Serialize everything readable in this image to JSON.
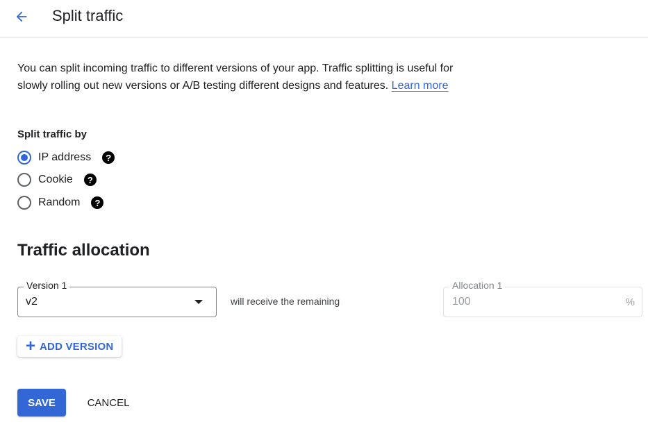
{
  "header": {
    "back_icon": "arrow-left-icon",
    "title": "Split traffic"
  },
  "description": {
    "text": "You can split incoming traffic to different versions of your app. Traffic splitting is useful for slowly rolling out new versions or A/B testing different designs and features. ",
    "link_label": "Learn more"
  },
  "split_by": {
    "label": "Split traffic by",
    "options": [
      {
        "label": "IP address",
        "checked": true,
        "help_icon": "help-circle-icon"
      },
      {
        "label": "Cookie",
        "checked": false,
        "help_icon": "help-circle-icon"
      },
      {
        "label": "Random",
        "checked": false,
        "help_icon": "help-circle-icon"
      }
    ]
  },
  "allocation": {
    "title": "Traffic allocation",
    "version_label": "Version 1",
    "version_value": "v2",
    "remaining_text": "will receive the remaining",
    "allocation_label": "Allocation 1",
    "allocation_value": "100",
    "unit": "%",
    "add_version_label": "ADD VERSION"
  },
  "actions": {
    "save_label": "SAVE",
    "cancel_label": "CANCEL"
  },
  "colors": {
    "accent": "#3367d6",
    "text": "#202124"
  }
}
